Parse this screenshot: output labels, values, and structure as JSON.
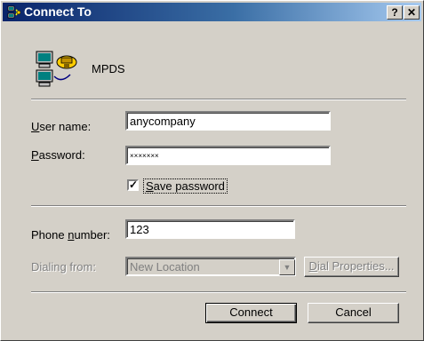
{
  "window": {
    "title": "Connect To",
    "help_label": "?",
    "close_label": "✕"
  },
  "connection": {
    "name": "MPDS",
    "icon": "dialup-connection-icon"
  },
  "credentials": {
    "username_label": "User name:",
    "username_value": "anycompany",
    "password_label": "Password:",
    "password_value": "×××××××",
    "save_password_label": "Save password",
    "save_password_checked": true
  },
  "dial": {
    "phone_label": "Phone number:",
    "phone_value": "123",
    "dialing_from_label": "Dialing from:",
    "dialing_from_value": "New Location",
    "dial_properties_label": "Dial Properties..."
  },
  "buttons": {
    "connect_label": "Connect",
    "cancel_label": "Cancel"
  },
  "colors": {
    "titlebar_start": "#0a246a",
    "titlebar_end": "#a6caf0",
    "face": "#d4d0c8"
  }
}
